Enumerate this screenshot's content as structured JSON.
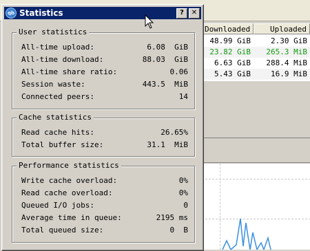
{
  "background": {
    "table": {
      "headers": [
        "Downloaded",
        "Uploaded"
      ],
      "rows": [
        {
          "downloaded": "48.99 GiB",
          "uploaded": "2.30 GiB",
          "color": "normal"
        },
        {
          "downloaded": "23.82 GiB",
          "uploaded": "265.3 MiB",
          "color": "green"
        },
        {
          "downloaded": "6.63 GiB",
          "uploaded": "288.4 MiB",
          "color": "normal"
        },
        {
          "downloaded": "5.43 GiB",
          "uploaded": "16.9 MiB",
          "color": "normal"
        }
      ]
    }
  },
  "dialog": {
    "title": "Statistics",
    "help_label": "?",
    "close_label": "✕",
    "app_icon_label": "qb"
  },
  "user_statistics": {
    "title": "User statistics",
    "rows": [
      {
        "label": "All-time upload:",
        "value": "6.08  GiB"
      },
      {
        "label": "All-time download:",
        "value": "88.03  GiB"
      },
      {
        "label": "All-time share ratio:",
        "value": "0.06"
      },
      {
        "label": "Session waste:",
        "value": "443.5  MiB"
      },
      {
        "label": "Connected peers:",
        "value": "14"
      }
    ]
  },
  "cache_statistics": {
    "title": "Cache statistics",
    "rows": [
      {
        "label": "Read cache hits:",
        "value": "26.65%"
      },
      {
        "label": "Total buffer size:",
        "value": "31.1  MiB"
      }
    ]
  },
  "performance_statistics": {
    "title": "Performance statistics",
    "rows": [
      {
        "label": "Write cache overload:",
        "value": "0%"
      },
      {
        "label": "Read cache overload:",
        "value": "0%"
      },
      {
        "label": "Queued I/O jobs:",
        "value": "0"
      },
      {
        "label": "Average time in queue:",
        "value": "2195 ms"
      },
      {
        "label": "Total queued size:",
        "value": "0  B"
      }
    ]
  },
  "colors": {
    "titlebar": "#0a246a",
    "green_row": "#139b13",
    "graph_line": "#3a8fe0"
  }
}
